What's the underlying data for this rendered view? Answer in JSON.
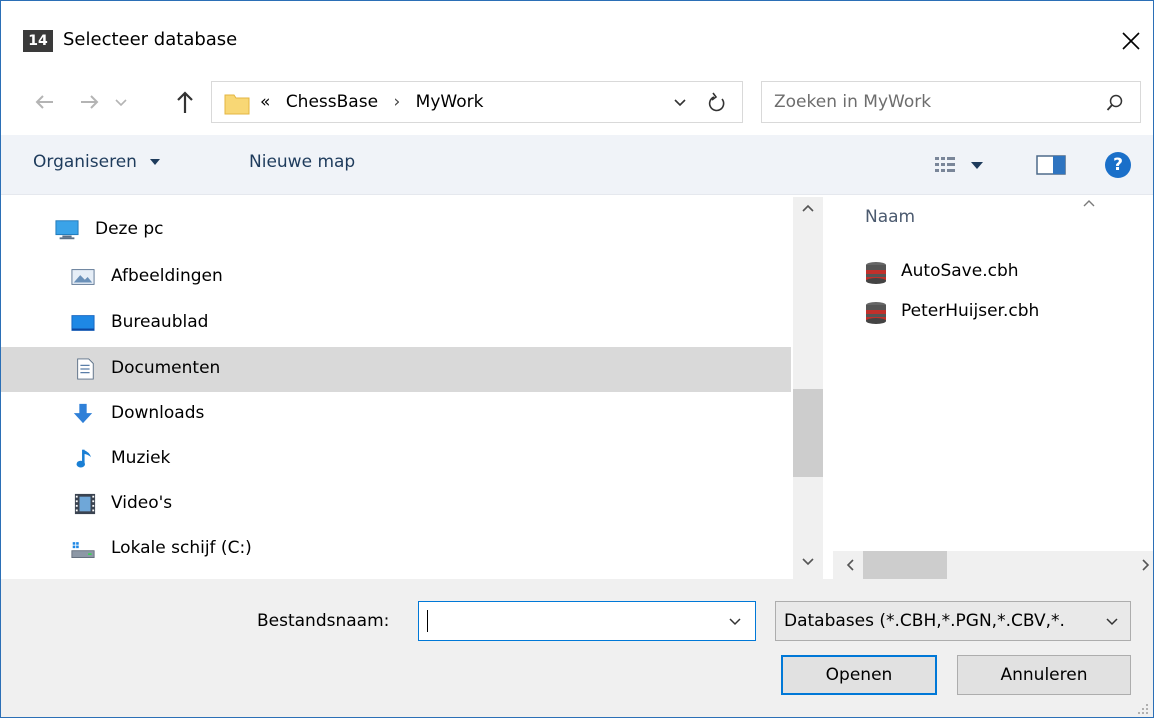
{
  "window": {
    "app_icon_text": "14",
    "title": "Selecteer database"
  },
  "address_bar": {
    "overflow": "«",
    "crumbs": [
      "ChessBase",
      "MyWork"
    ],
    "separator": "›"
  },
  "search": {
    "placeholder": "Zoeken in MyWork"
  },
  "toolbar": {
    "organize_label": "Organiseren",
    "new_folder_label": "Nieuwe map",
    "help_label": "?"
  },
  "nav_pane": {
    "items": [
      {
        "label": "Deze pc",
        "icon": "computer-icon"
      },
      {
        "label": "Afbeeldingen",
        "icon": "pictures-icon"
      },
      {
        "label": "Bureaublad",
        "icon": "desktop-icon"
      },
      {
        "label": "Documenten",
        "icon": "documents-icon",
        "selected": true
      },
      {
        "label": "Downloads",
        "icon": "downloads-icon"
      },
      {
        "label": "Muziek",
        "icon": "music-icon"
      },
      {
        "label": "Video's",
        "icon": "videos-icon"
      },
      {
        "label": "Lokale schijf (C:)",
        "icon": "local-disk-icon"
      }
    ]
  },
  "file_list": {
    "column_header": "Naam",
    "files": [
      {
        "name": "AutoSave.cbh",
        "icon": "database-file-icon"
      },
      {
        "name": "PeterHuijser.cbh",
        "icon": "database-file-icon"
      }
    ]
  },
  "bottom": {
    "filename_label": "Bestandsnaam:",
    "filename_value": "",
    "filetype_selected": "Databases (*.CBH,*.PGN,*.CBV,*.",
    "open_label": "Openen",
    "cancel_label": "Annuleren"
  },
  "colors": {
    "accent": "#0078d7",
    "window_border": "#2b6fb6",
    "toolbar_bg": "#f0f3f8",
    "selection_bg": "#d9d9d9",
    "help_blue": "#1a6fc9"
  }
}
